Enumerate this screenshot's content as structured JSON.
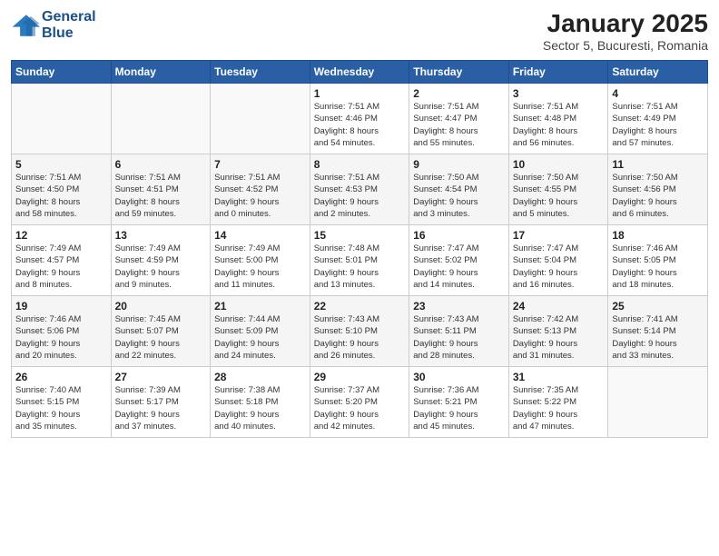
{
  "header": {
    "logo_line1": "General",
    "logo_line2": "Blue",
    "title": "January 2025",
    "subtitle": "Sector 5, Bucuresti, Romania"
  },
  "weekdays": [
    "Sunday",
    "Monday",
    "Tuesday",
    "Wednesday",
    "Thursday",
    "Friday",
    "Saturday"
  ],
  "weeks": [
    [
      {
        "day": "",
        "info": ""
      },
      {
        "day": "",
        "info": ""
      },
      {
        "day": "",
        "info": ""
      },
      {
        "day": "1",
        "info": "Sunrise: 7:51 AM\nSunset: 4:46 PM\nDaylight: 8 hours\nand 54 minutes."
      },
      {
        "day": "2",
        "info": "Sunrise: 7:51 AM\nSunset: 4:47 PM\nDaylight: 8 hours\nand 55 minutes."
      },
      {
        "day": "3",
        "info": "Sunrise: 7:51 AM\nSunset: 4:48 PM\nDaylight: 8 hours\nand 56 minutes."
      },
      {
        "day": "4",
        "info": "Sunrise: 7:51 AM\nSunset: 4:49 PM\nDaylight: 8 hours\nand 57 minutes."
      }
    ],
    [
      {
        "day": "5",
        "info": "Sunrise: 7:51 AM\nSunset: 4:50 PM\nDaylight: 8 hours\nand 58 minutes."
      },
      {
        "day": "6",
        "info": "Sunrise: 7:51 AM\nSunset: 4:51 PM\nDaylight: 8 hours\nand 59 minutes."
      },
      {
        "day": "7",
        "info": "Sunrise: 7:51 AM\nSunset: 4:52 PM\nDaylight: 9 hours\nand 0 minutes."
      },
      {
        "day": "8",
        "info": "Sunrise: 7:51 AM\nSunset: 4:53 PM\nDaylight: 9 hours\nand 2 minutes."
      },
      {
        "day": "9",
        "info": "Sunrise: 7:50 AM\nSunset: 4:54 PM\nDaylight: 9 hours\nand 3 minutes."
      },
      {
        "day": "10",
        "info": "Sunrise: 7:50 AM\nSunset: 4:55 PM\nDaylight: 9 hours\nand 5 minutes."
      },
      {
        "day": "11",
        "info": "Sunrise: 7:50 AM\nSunset: 4:56 PM\nDaylight: 9 hours\nand 6 minutes."
      }
    ],
    [
      {
        "day": "12",
        "info": "Sunrise: 7:49 AM\nSunset: 4:57 PM\nDaylight: 9 hours\nand 8 minutes."
      },
      {
        "day": "13",
        "info": "Sunrise: 7:49 AM\nSunset: 4:59 PM\nDaylight: 9 hours\nand 9 minutes."
      },
      {
        "day": "14",
        "info": "Sunrise: 7:49 AM\nSunset: 5:00 PM\nDaylight: 9 hours\nand 11 minutes."
      },
      {
        "day": "15",
        "info": "Sunrise: 7:48 AM\nSunset: 5:01 PM\nDaylight: 9 hours\nand 13 minutes."
      },
      {
        "day": "16",
        "info": "Sunrise: 7:47 AM\nSunset: 5:02 PM\nDaylight: 9 hours\nand 14 minutes."
      },
      {
        "day": "17",
        "info": "Sunrise: 7:47 AM\nSunset: 5:04 PM\nDaylight: 9 hours\nand 16 minutes."
      },
      {
        "day": "18",
        "info": "Sunrise: 7:46 AM\nSunset: 5:05 PM\nDaylight: 9 hours\nand 18 minutes."
      }
    ],
    [
      {
        "day": "19",
        "info": "Sunrise: 7:46 AM\nSunset: 5:06 PM\nDaylight: 9 hours\nand 20 minutes."
      },
      {
        "day": "20",
        "info": "Sunrise: 7:45 AM\nSunset: 5:07 PM\nDaylight: 9 hours\nand 22 minutes."
      },
      {
        "day": "21",
        "info": "Sunrise: 7:44 AM\nSunset: 5:09 PM\nDaylight: 9 hours\nand 24 minutes."
      },
      {
        "day": "22",
        "info": "Sunrise: 7:43 AM\nSunset: 5:10 PM\nDaylight: 9 hours\nand 26 minutes."
      },
      {
        "day": "23",
        "info": "Sunrise: 7:43 AM\nSunset: 5:11 PM\nDaylight: 9 hours\nand 28 minutes."
      },
      {
        "day": "24",
        "info": "Sunrise: 7:42 AM\nSunset: 5:13 PM\nDaylight: 9 hours\nand 31 minutes."
      },
      {
        "day": "25",
        "info": "Sunrise: 7:41 AM\nSunset: 5:14 PM\nDaylight: 9 hours\nand 33 minutes."
      }
    ],
    [
      {
        "day": "26",
        "info": "Sunrise: 7:40 AM\nSunset: 5:15 PM\nDaylight: 9 hours\nand 35 minutes."
      },
      {
        "day": "27",
        "info": "Sunrise: 7:39 AM\nSunset: 5:17 PM\nDaylight: 9 hours\nand 37 minutes."
      },
      {
        "day": "28",
        "info": "Sunrise: 7:38 AM\nSunset: 5:18 PM\nDaylight: 9 hours\nand 40 minutes."
      },
      {
        "day": "29",
        "info": "Sunrise: 7:37 AM\nSunset: 5:20 PM\nDaylight: 9 hours\nand 42 minutes."
      },
      {
        "day": "30",
        "info": "Sunrise: 7:36 AM\nSunset: 5:21 PM\nDaylight: 9 hours\nand 45 minutes."
      },
      {
        "day": "31",
        "info": "Sunrise: 7:35 AM\nSunset: 5:22 PM\nDaylight: 9 hours\nand 47 minutes."
      },
      {
        "day": "",
        "info": ""
      }
    ]
  ]
}
